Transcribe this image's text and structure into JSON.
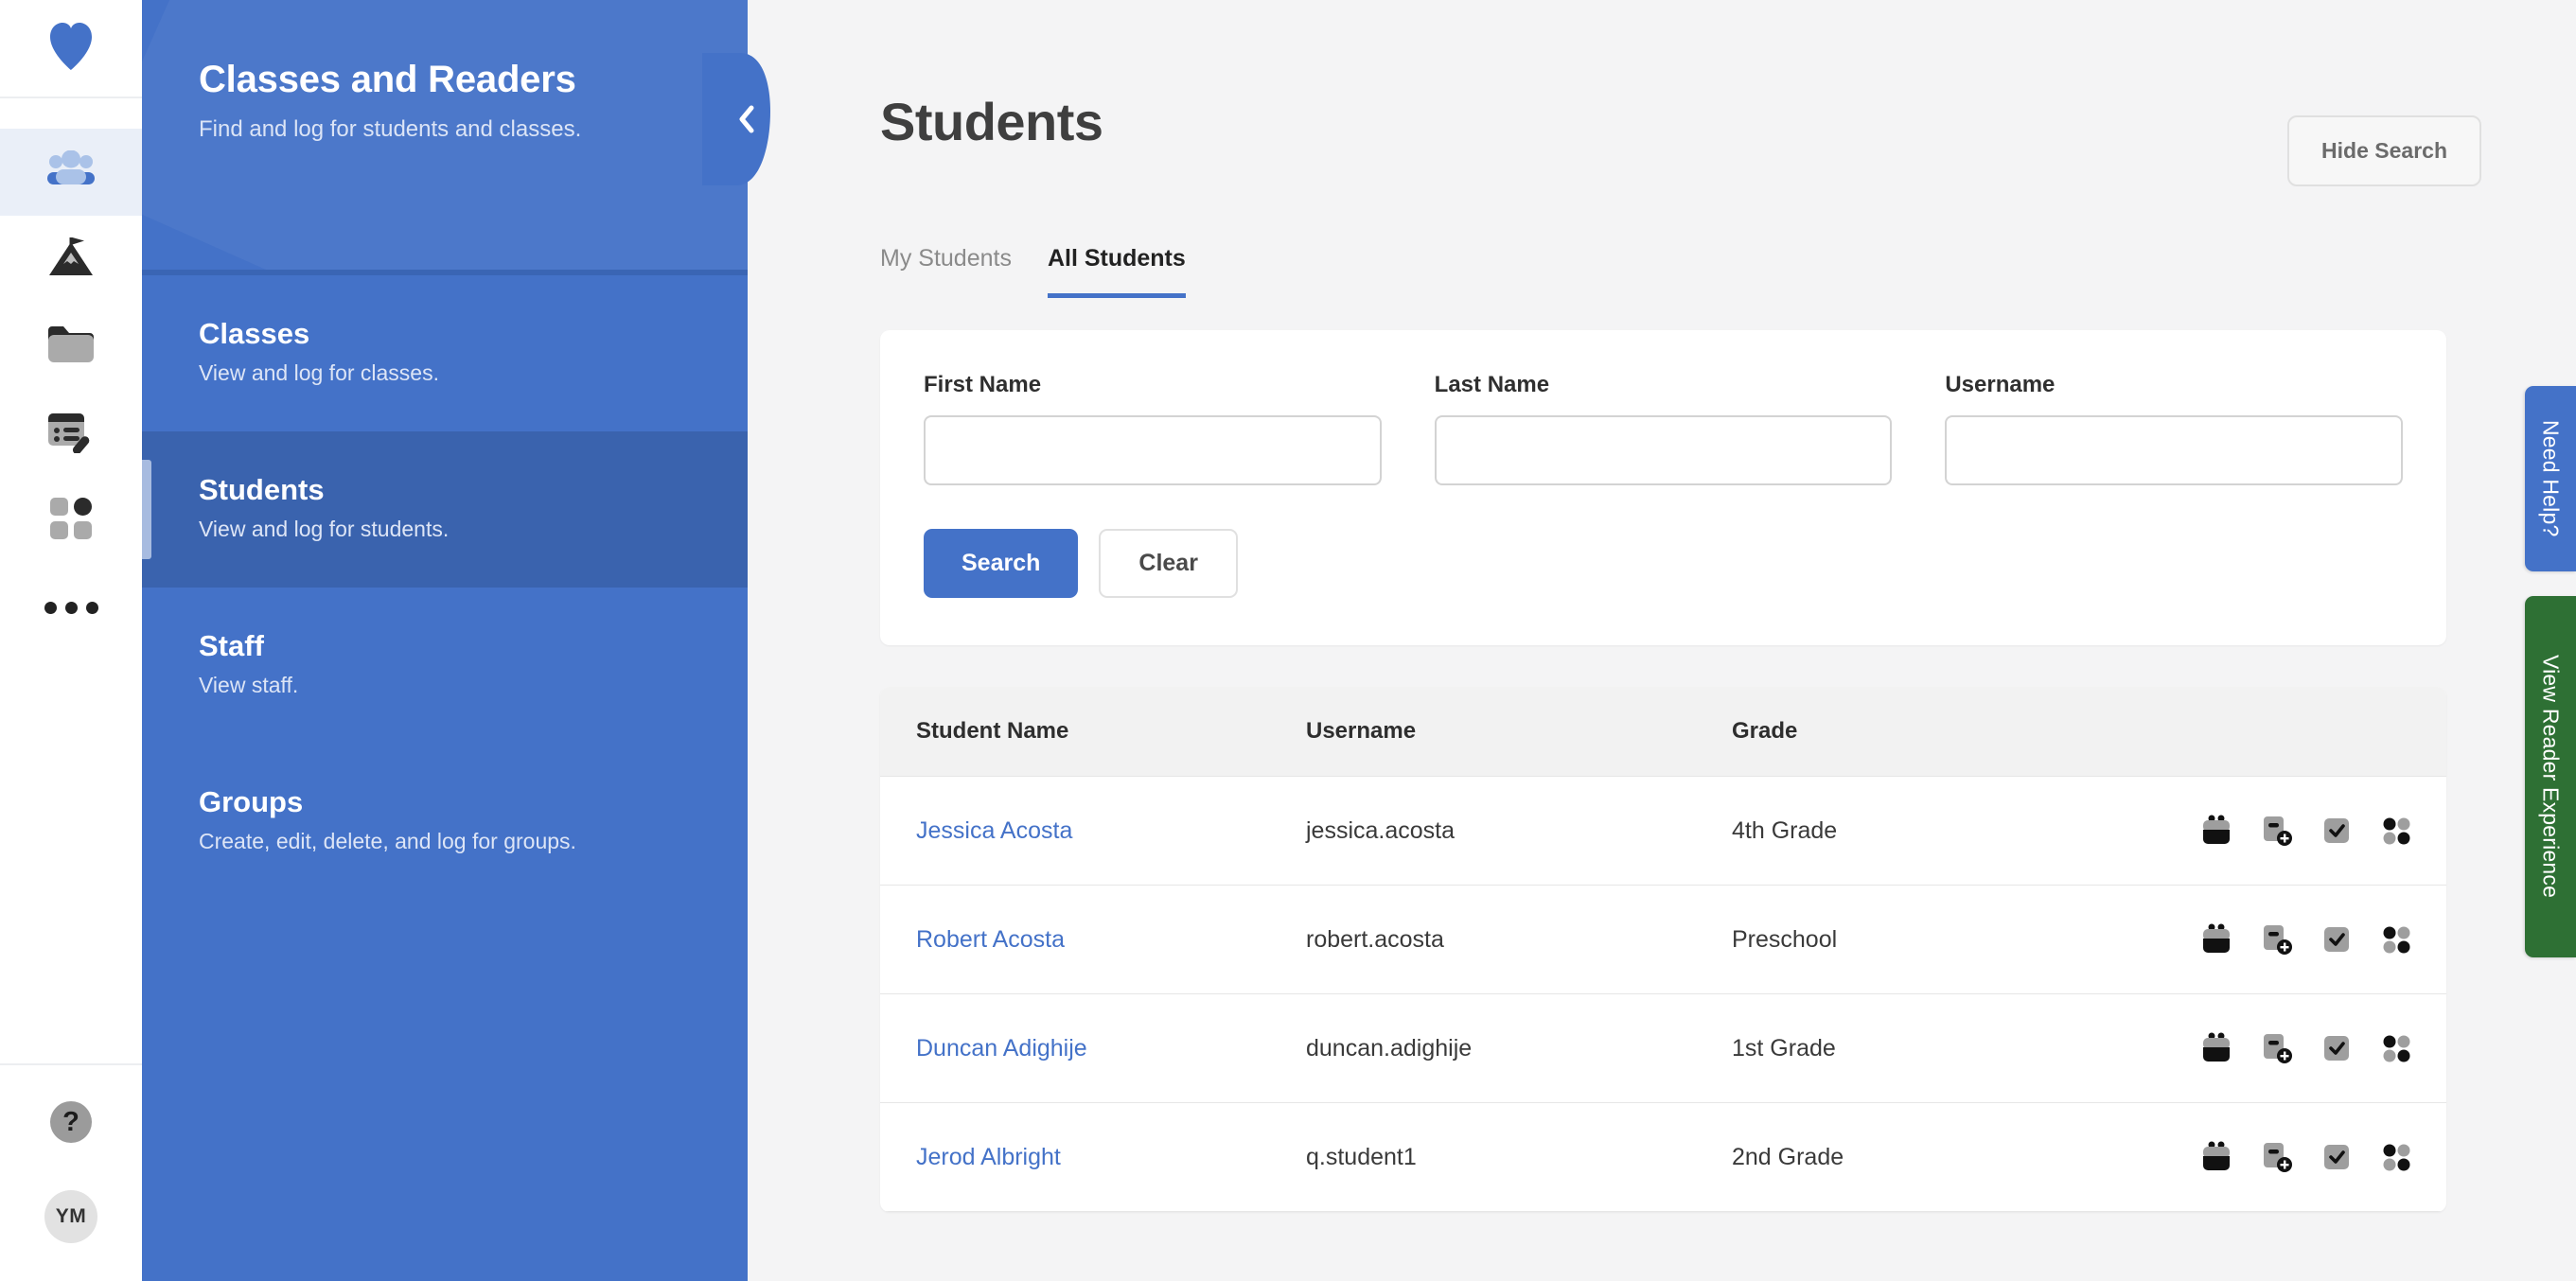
{
  "rail": {
    "logo_icon": "heart-logo-icon",
    "items": [
      {
        "icon": "people-group-icon",
        "name": "classes-and-readers",
        "active": true
      },
      {
        "icon": "mountain-flag-icon",
        "name": "goals",
        "active": false
      },
      {
        "icon": "folder-icon",
        "name": "resources",
        "active": false
      },
      {
        "icon": "form-edit-icon",
        "name": "logging",
        "active": false
      },
      {
        "icon": "grid-apps-icon",
        "name": "apps",
        "active": false
      },
      {
        "icon": "more-dots-icon",
        "name": "more",
        "active": false
      }
    ],
    "help_label": "?",
    "avatar_initials": "YM"
  },
  "nav": {
    "title": "Classes and Readers",
    "subtitle": "Find and log for students and classes.",
    "collapse_icon": "chevron-left-icon",
    "items": [
      {
        "title": "Classes",
        "desc": "View and log for classes.",
        "active": false
      },
      {
        "title": "Students",
        "desc": "View and log for students.",
        "active": true
      },
      {
        "title": "Staff",
        "desc": "View staff.",
        "active": false
      },
      {
        "title": "Groups",
        "desc": "Create, edit, delete, and log for groups.",
        "active": false
      }
    ]
  },
  "main": {
    "page_title": "Students",
    "hide_search_label": "Hide Search",
    "tabs": [
      {
        "label": "My Students",
        "active": false
      },
      {
        "label": "All Students",
        "active": true
      }
    ],
    "search": {
      "first_name": {
        "label": "First Name",
        "value": "",
        "placeholder": ""
      },
      "last_name": {
        "label": "Last Name",
        "value": "",
        "placeholder": ""
      },
      "username": {
        "label": "Username",
        "value": "",
        "placeholder": ""
      },
      "search_label": "Search",
      "clear_label": "Clear"
    },
    "table": {
      "columns": [
        "Student Name",
        "Username",
        "Grade"
      ],
      "row_action_icons": [
        "backpack-icon",
        "add-log-icon",
        "checkbox-checked-icon",
        "dot-grid-icon"
      ],
      "rows": [
        {
          "name": "Jessica Acosta",
          "username": "jessica.acosta",
          "grade": "4th Grade"
        },
        {
          "name": "Robert Acosta",
          "username": "robert.acosta",
          "grade": "Preschool"
        },
        {
          "name": "Duncan Adighije",
          "username": "duncan.adighije",
          "grade": "1st Grade"
        },
        {
          "name": "Jerod Albright",
          "username": "q.student1",
          "grade": "2nd Grade"
        }
      ]
    }
  },
  "side_tabs": [
    {
      "label": "Need Help?",
      "color": "#4472c8"
    },
    {
      "label": "View Reader Experience",
      "color": "#2e7034"
    }
  ],
  "colors": {
    "brand_blue": "#4472c8",
    "nav_active_blue": "#3a63ae",
    "link_blue": "#4472c8",
    "green": "#2e7034",
    "page_bg": "#f4f4f5"
  }
}
